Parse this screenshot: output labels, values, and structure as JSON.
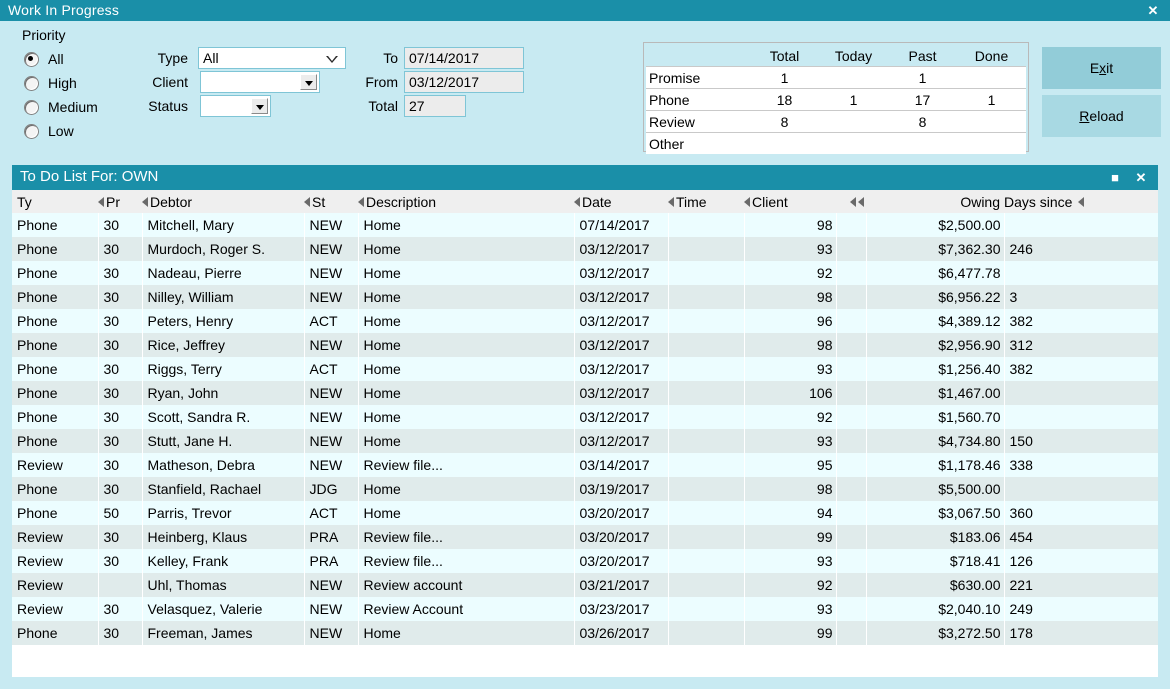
{
  "window": {
    "title": "Work In Progress",
    "close_label": "✕"
  },
  "filters": {
    "priority_group_label": "Priority",
    "priority_options": [
      {
        "label": "All",
        "selected": true
      },
      {
        "label": "High",
        "selected": false
      },
      {
        "label": "Medium",
        "selected": false
      },
      {
        "label": "Low",
        "selected": false
      }
    ],
    "type_label": "Type",
    "type_value": "All",
    "client_label": "Client",
    "client_value": "",
    "status_label": "Status",
    "status_value": "",
    "to_label": "To",
    "to_value": "07/14/2017",
    "from_label": "From",
    "from_value": "03/12/2017",
    "total_label": "Total",
    "total_value": "27"
  },
  "summary": {
    "columns": [
      "",
      "Total",
      "Today",
      "Past",
      "Done"
    ],
    "rows": [
      {
        "name": "Promise",
        "total": "1",
        "today": "",
        "past": "1",
        "done": ""
      },
      {
        "name": "Phone",
        "total": "18",
        "today": "1",
        "past": "17",
        "done": "1"
      },
      {
        "name": "Review",
        "total": "8",
        "today": "",
        "past": "8",
        "done": ""
      },
      {
        "name": "Other",
        "total": "",
        "today": "",
        "past": "",
        "done": ""
      }
    ]
  },
  "actions": {
    "exit_pre": "E",
    "exit_mnem": "x",
    "exit_post": "it",
    "reload_mnem": "R",
    "reload_post": "eload"
  },
  "todo": {
    "title": "To Do List For:  OWN",
    "restore_label": "■",
    "close_label": "✕",
    "columns": [
      "Ty",
      "Pr",
      "Debtor",
      "St",
      "Description",
      "Date",
      "Time",
      "Client",
      "",
      "Owing",
      "Days since"
    ],
    "rows": [
      {
        "ty": "Phone",
        "pr": "30",
        "debtor": "Mitchell, Mary",
        "st": "NEW",
        "description": "Home",
        "date": "07/14/2017",
        "time": "",
        "client": "98",
        "blank": "",
        "owing": "$2,500.00",
        "days": ""
      },
      {
        "ty": "Phone",
        "pr": "30",
        "debtor": "Murdoch, Roger S.",
        "st": "NEW",
        "description": "Home",
        "date": "03/12/2017",
        "time": "",
        "client": "93",
        "blank": "",
        "owing": "$7,362.30",
        "days": "246"
      },
      {
        "ty": "Phone",
        "pr": "30",
        "debtor": "Nadeau, Pierre",
        "st": "NEW",
        "description": "Home",
        "date": "03/12/2017",
        "time": "",
        "client": "92",
        "blank": "",
        "owing": "$6,477.78",
        "days": ""
      },
      {
        "ty": "Phone",
        "pr": "30",
        "debtor": "Nilley, William",
        "st": "NEW",
        "description": "Home",
        "date": "03/12/2017",
        "time": "",
        "client": "98",
        "blank": "",
        "owing": "$6,956.22",
        "days": "3"
      },
      {
        "ty": "Phone",
        "pr": "30",
        "debtor": "Peters, Henry",
        "st": "ACT",
        "description": "Home",
        "date": "03/12/2017",
        "time": "",
        "client": "96",
        "blank": "",
        "owing": "$4,389.12",
        "days": "382"
      },
      {
        "ty": "Phone",
        "pr": "30",
        "debtor": "Rice, Jeffrey",
        "st": "NEW",
        "description": "Home",
        "date": "03/12/2017",
        "time": "",
        "client": "98",
        "blank": "",
        "owing": "$2,956.90",
        "days": "312"
      },
      {
        "ty": "Phone",
        "pr": "30",
        "debtor": "Riggs, Terry",
        "st": "ACT",
        "description": "Home",
        "date": "03/12/2017",
        "time": "",
        "client": "93",
        "blank": "",
        "owing": "$1,256.40",
        "days": "382"
      },
      {
        "ty": "Phone",
        "pr": "30",
        "debtor": "Ryan, John",
        "st": "NEW",
        "description": "Home",
        "date": "03/12/2017",
        "time": "",
        "client": "106",
        "blank": "",
        "owing": "$1,467.00",
        "days": ""
      },
      {
        "ty": "Phone",
        "pr": "30",
        "debtor": "Scott, Sandra R.",
        "st": "NEW",
        "description": "Home",
        "date": "03/12/2017",
        "time": "",
        "client": "92",
        "blank": "",
        "owing": "$1,560.70",
        "days": ""
      },
      {
        "ty": "Phone",
        "pr": "30",
        "debtor": "Stutt, Jane H.",
        "st": "NEW",
        "description": "Home",
        "date": "03/12/2017",
        "time": "",
        "client": "93",
        "blank": "",
        "owing": "$4,734.80",
        "days": "150"
      },
      {
        "ty": "Review",
        "pr": "30",
        "debtor": "Matheson, Debra",
        "st": "NEW",
        "description": "Review file...",
        "date": "03/14/2017",
        "time": "",
        "client": "95",
        "blank": "",
        "owing": "$1,178.46",
        "days": "338"
      },
      {
        "ty": "Phone",
        "pr": "30",
        "debtor": "Stanfield, Rachael",
        "st": "JDG",
        "description": "Home",
        "date": "03/19/2017",
        "time": "",
        "client": "98",
        "blank": "",
        "owing": "$5,500.00",
        "days": ""
      },
      {
        "ty": "Phone",
        "pr": "50",
        "debtor": "Parris, Trevor",
        "st": "ACT",
        "description": "Home",
        "date": "03/20/2017",
        "time": "",
        "client": "94",
        "blank": "",
        "owing": "$3,067.50",
        "days": "360"
      },
      {
        "ty": "Review",
        "pr": "30",
        "debtor": "Heinberg, Klaus",
        "st": "PRA",
        "description": "Review file...",
        "date": "03/20/2017",
        "time": "",
        "client": "99",
        "blank": "",
        "owing": "$183.06",
        "days": "454"
      },
      {
        "ty": "Review",
        "pr": "30",
        "debtor": "Kelley, Frank",
        "st": "PRA",
        "description": "Review file...",
        "date": "03/20/2017",
        "time": "",
        "client": "93",
        "blank": "",
        "owing": "$718.41",
        "days": "126"
      },
      {
        "ty": "Review",
        "pr": "",
        "debtor": "Uhl, Thomas",
        "st": "NEW",
        "description": "Review account",
        "date": "03/21/2017",
        "time": "",
        "client": "92",
        "blank": "",
        "owing": "$630.00",
        "days": "221"
      },
      {
        "ty": "Review",
        "pr": "30",
        "debtor": "Velasquez, Valerie",
        "st": "NEW",
        "description": "Review Account",
        "date": "03/23/2017",
        "time": "",
        "client": "93",
        "blank": "",
        "owing": "$2,040.10",
        "days": "249"
      },
      {
        "ty": "Phone",
        "pr": "30",
        "debtor": "Freeman, James",
        "st": "NEW",
        "description": "Home",
        "date": "03/26/2017",
        "time": "",
        "client": "99",
        "blank": "",
        "owing": "$3,272.50",
        "days": "178"
      }
    ]
  },
  "colors": {
    "titlebar": "#1a8fa8",
    "page_bg": "#c8eaf2",
    "row_odd": "#ecfdff",
    "row_even": "#e0ebeb",
    "button": "#a8d9e3"
  }
}
